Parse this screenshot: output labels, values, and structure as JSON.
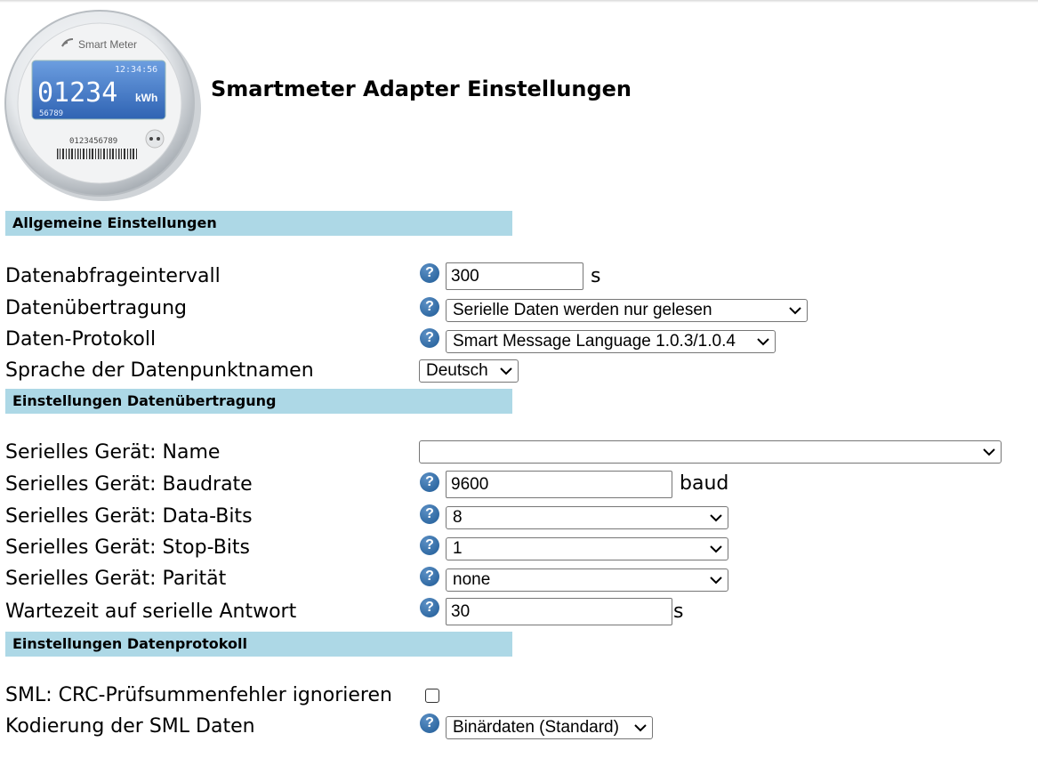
{
  "header": {
    "title": "Smartmeter Adapter Einstellungen",
    "logo": {
      "brand": "Smart Meter",
      "time": "12:34:56",
      "reading": "01234",
      "unit": "kWh",
      "sub_number": "56789",
      "serial": "0123456789"
    }
  },
  "sections": {
    "general": "Allgemeine Einstellungen",
    "transfer": "Einstellungen Datenübertragung",
    "protocol": "Einstellungen Datenprotokoll"
  },
  "general": {
    "interval": {
      "label": "Datenabfrageintervall",
      "value": "300",
      "unit": "s"
    },
    "transfer_mode": {
      "label": "Datenübertragung",
      "selected": "Serielle Daten werden nur gelesen"
    },
    "protocol": {
      "label": "Daten-Protokoll",
      "selected": "Smart Message Language 1.0.3/1.0.4"
    },
    "language": {
      "label": "Sprache der Datenpunktnamen",
      "selected": "Deutsch"
    }
  },
  "serial": {
    "device": {
      "label": "Serielles Gerät: Name",
      "selected": ""
    },
    "baudrate": {
      "label": "Serielles Gerät: Baudrate",
      "value": "9600",
      "unit": "baud"
    },
    "databits": {
      "label": "Serielles Gerät: Data-Bits",
      "selected": "8"
    },
    "stopbits": {
      "label": "Serielles Gerät: Stop-Bits",
      "selected": "1"
    },
    "parity": {
      "label": "Serielles Gerät: Parität",
      "selected": "none"
    },
    "timeout": {
      "label": "Wartezeit auf serielle Antwort",
      "value": "30",
      "unit": "s"
    }
  },
  "protocol": {
    "crc": {
      "label": "SML: CRC-Prüfsummenfehler ignorieren",
      "checked": false
    },
    "encoding": {
      "label": "Kodierung der SML Daten",
      "selected": "Binärdaten (Standard)"
    }
  },
  "help_glyph": "?",
  "icons": {
    "help": "help-circle-icon",
    "chevron": "chevron-down-icon",
    "logo": "smart-meter-logo"
  },
  "colors": {
    "section_bg": "#add8e6",
    "help_icon": "#2a6aa8",
    "meter_display": "#3f77c7"
  }
}
